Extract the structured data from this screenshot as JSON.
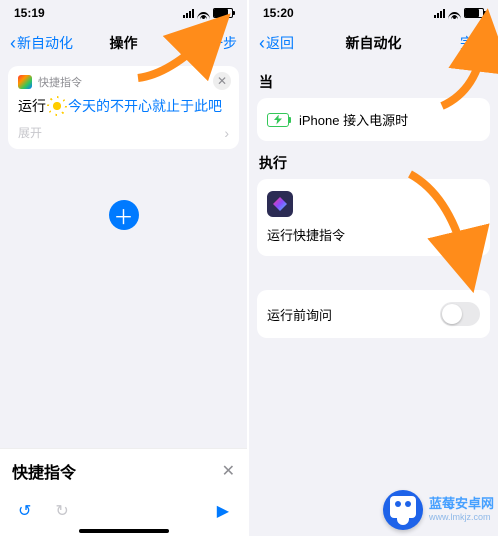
{
  "left": {
    "status": {
      "time": "15:19",
      "signal_alt": "signal",
      "wifi_alt": "wifi",
      "battery_alt": "battery"
    },
    "nav": {
      "back": "新自动化",
      "title": "操作",
      "next": "下一步"
    },
    "card": {
      "app_label": "快捷指令",
      "run_prefix": "运行",
      "shortcut_name": "今天的不开心就止于此吧",
      "expand": "展开"
    },
    "add_plus": "＋",
    "input_placeholder": "快捷指令",
    "toolbar": {
      "undo": "↺",
      "redo": "↻",
      "play": "▶"
    }
  },
  "right": {
    "status": {
      "time": "15:20",
      "signal_alt": "signal",
      "wifi_alt": "wifi",
      "battery_alt": "battery"
    },
    "nav": {
      "back": "返回",
      "title": "新自动化",
      "done": "完成"
    },
    "sections": {
      "when": "当",
      "when_item": "iPhone 接入电源时",
      "do": "执行",
      "do_item": "运行快捷指令",
      "ask": "运行前询问"
    }
  },
  "watermark": {
    "title": "蓝莓安卓网",
    "url": "www.lmkjz.com"
  }
}
